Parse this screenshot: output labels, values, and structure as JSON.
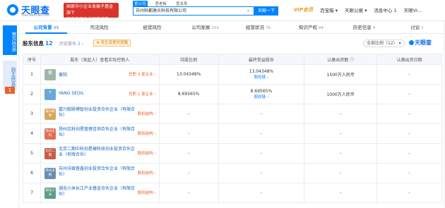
{
  "header": {
    "logo_text": "天眼查",
    "logo_sub": "TianYancha.com",
    "promo_line1": "国家中小企业发展子基金旗下",
    "promo_line2": "官方备案企业征信机构",
    "search_tabs": [
      "查公司",
      "查老板",
      "查关系"
    ],
    "search_value": "苏州科都激光科技有限公司",
    "search_button": "天眼一下",
    "vip_label": "VIP会员",
    "nav": [
      "百宝箱",
      "天眼公报",
      "消息中心",
      "天眼VI..."
    ],
    "msg_count": "1"
  },
  "sidebar": {
    "tab1": "官方信息",
    "tab2": "自主信息",
    "tab2_count": "1"
  },
  "tabs": [
    {
      "label": "公司背景",
      "count": "35"
    },
    {
      "label": "司法风险",
      "count": ""
    },
    {
      "label": "经营风险",
      "count": ""
    },
    {
      "label": "公司发展",
      "count": "103"
    },
    {
      "label": "经营状况",
      "count": "76"
    },
    {
      "label": "知识产权",
      "count": "84"
    },
    {
      "label": "历史信息",
      "count": "9"
    },
    {
      "label": "讨论",
      "count": "1"
    }
  ],
  "section": {
    "title": "股东信息",
    "count": "12",
    "history_label": "历史股东",
    "history_count": "1",
    "badge": "★ 发生变更时提醒",
    "sort_label": "全部比例（12）",
    "watermark": "天眼查"
  },
  "table": {
    "headers": [
      "序号",
      "股东（发起人）查看实际控制人",
      "持股比例",
      "最终受益股份",
      "认缴出资额 ⓘ",
      "认缴出资日期"
    ],
    "rows": [
      {
        "no": "1",
        "avatar": "黄",
        "name": "黄阳",
        "tag": "任职 3 家企业 ›",
        "ratio": "13.04348%",
        "final": "13.04348%",
        "final_link": "股权链 ›",
        "amount": "1500万人民币",
        "date": "-"
      },
      {
        "no": "2",
        "avatar": "Y",
        "name": "YANG SEOIL",
        "tag": "任职 1 家企业 ›",
        "ratio": "8.69565%",
        "final": "8.69565%",
        "final_link": "股权链 ›",
        "amount": "1000万人民币",
        "date": "-"
      },
      {
        "no": "3",
        "avatar": "嘉兴毅颐",
        "name": "嘉兴毅颐博智创业投资合伙企业（有限合伙）",
        "tag": "股权结构 ›",
        "ratio": "-",
        "final": "-",
        "final_link": "",
        "amount": "-",
        "date": "-"
      },
      {
        "no": "4",
        "avatar": "扬州志科",
        "name": "扬州志科创星管理咨询合伙企业（有限合伙）",
        "tag": "股权结构 ›",
        "ratio": "-",
        "final": "-",
        "final_link": "",
        "amount": "-",
        "date": "-"
      },
      {
        "no": "5",
        "avatar": "北京二期",
        "name": "北京二期中科创星硬科技创业投资合伙企业（有限合伙）",
        "tag": "股权结构 ›",
        "ratio": "-",
        "final": "-",
        "final_link": "",
        "amount": "-",
        "date": "-"
      },
      {
        "no": "6",
        "avatar": "苏州沃赋",
        "name": "苏州沃赋睿鑫创业投资合伙企业（有限合伙）",
        "tag": "股权结构 ›",
        "ratio": "-",
        "final": "-",
        "final_link": "",
        "amount": "-",
        "date": "-"
      },
      {
        "no": "7",
        "avatar": "湖北小米",
        "name": "湖北小米长江产业基金合伙企业（有限合伙）",
        "tag": "股权结构 ›",
        "ratio": "-",
        "final": "-",
        "final_link": "",
        "amount": "-",
        "date": "-"
      }
    ]
  }
}
